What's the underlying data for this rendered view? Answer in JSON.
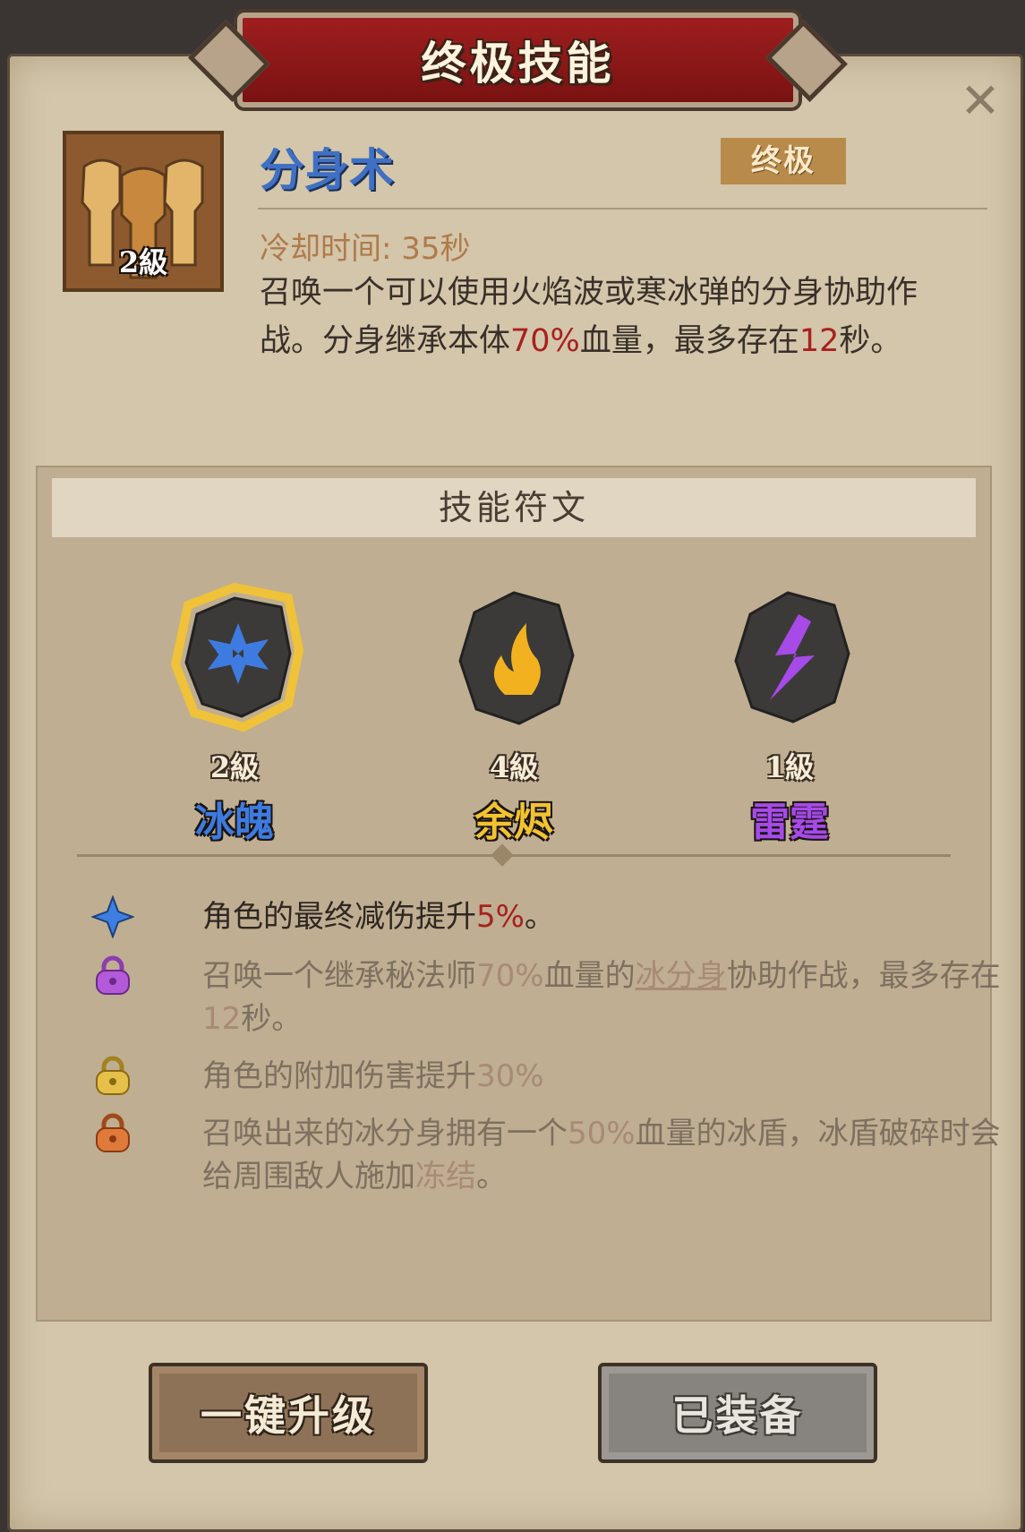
{
  "header": {
    "title": "终极技能",
    "close_icon": "close-icon"
  },
  "skill": {
    "name": "分身术",
    "level": "2級",
    "tier": "终极",
    "cooldown": "冷却时间: 35秒",
    "description": {
      "part1": "召唤一个可以使用火焰波或寒冰弹的分身协助作战。分身继承本体",
      "hp_percent": "70%",
      "part2": "血量，最多存在",
      "duration": "12",
      "part3": "秒。"
    }
  },
  "runes": {
    "title": "技能符文",
    "items": [
      {
        "name": "冰魄",
        "level": "2級",
        "color": "#3e7be0",
        "selected": true,
        "icon": "ice-crystal-icon"
      },
      {
        "name": "余烬",
        "level": "4級",
        "color": "#f2c230",
        "selected": false,
        "icon": "flame-icon"
      },
      {
        "name": "雷霆",
        "level": "1級",
        "color": "#a64ae8",
        "selected": false,
        "icon": "lightning-icon"
      }
    ],
    "effects": [
      {
        "icon": "blue-star-icon",
        "state": "active",
        "t1": "角色的最终减伤提升",
        "v1": "5%",
        "t2": "。"
      },
      {
        "icon": "purple-lock-icon",
        "state": "locked",
        "t1": "召唤一个继承秘法师",
        "v1": "70%",
        "t2": "血量的",
        "link": "冰分身",
        "t3": "协助作战，最多存在",
        "v2": "12",
        "t4": "秒。"
      },
      {
        "icon": "gold-lock-icon",
        "state": "locked",
        "t1": "角色的附加伤害提升",
        "v1": "30%"
      },
      {
        "icon": "orange-lock-icon",
        "state": "locked",
        "t1": "召唤出来的冰分身拥有一个",
        "v1": "50%",
        "t2": "血量的冰盾，冰盾破碎时会给周围敌人施加",
        "v2": "冻结",
        "t3": "。"
      }
    ]
  },
  "buttons": {
    "upgrade": "一键升级",
    "equipped": "已装备"
  },
  "colors": {
    "accent_red": "#a82020",
    "title_red": "#9e1e1e",
    "panel": "#d3c6aa"
  }
}
